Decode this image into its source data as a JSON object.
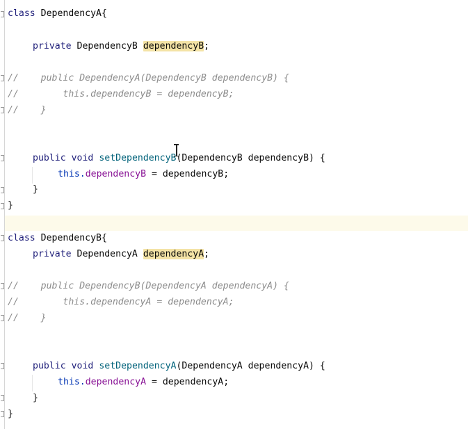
{
  "code": {
    "class_a": {
      "keyword": "class",
      "name": "DependencyA{",
      "field_line": {
        "modifier": "private",
        "type": "DependencyB",
        "name": "dependencyB",
        "end": ";"
      },
      "comment_1": "//    public DependencyA(DependencyB dependencyB) {",
      "comment_2": "//        this.dependencyB = dependencyB;",
      "comment_3": "//    }",
      "setter": {
        "public": "public",
        "void": "void",
        "name": "setDependencyB",
        "params": "(DependencyB dependencyB) {"
      },
      "body": {
        "this": "this.",
        "field": "dependencyB",
        "rest": " = dependencyB;"
      },
      "method_close": "}",
      "class_close": "}"
    },
    "class_b": {
      "keyword": "class",
      "name": "DependencyB{",
      "field_line": {
        "modifier": "private",
        "type": "DependencyA",
        "name": "dependencyA",
        "end": ";"
      },
      "comment_1": "//    public DependencyB(DependencyA dependencyA) {",
      "comment_2": "//        this.dependencyA = dependencyA;",
      "comment_3": "//    }",
      "setter": {
        "public": "public",
        "void": "void",
        "name": "setDependencyA",
        "params": "(DependencyA dependencyA) {"
      },
      "body": {
        "this": "this.",
        "field": "dependencyA",
        "rest": " = dependencyA;"
      },
      "method_close": "}",
      "class_close": "}"
    }
  },
  "colors": {
    "keyword": "#0033b3",
    "field": "#871094",
    "comment": "#8c8c8c",
    "method": "#00627a",
    "highlight": "#f4e3a6",
    "caret_line": "#fdfaea"
  },
  "icons": {
    "cursor": "text-cursor-icon",
    "fold": "fold-marker-icon"
  }
}
